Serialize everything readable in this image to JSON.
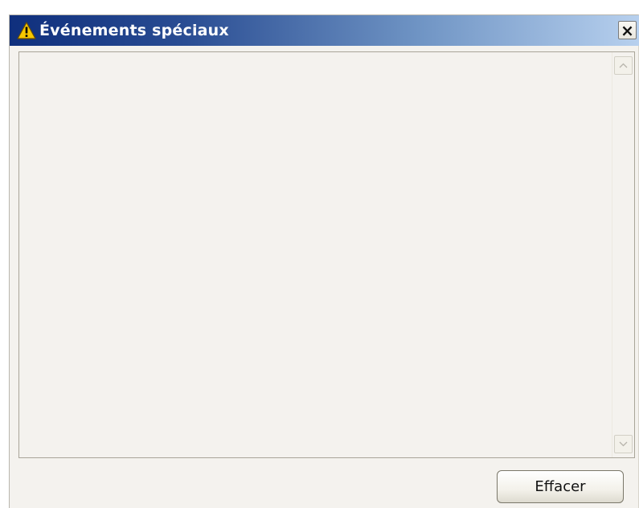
{
  "window": {
    "title": "Événements spéciaux",
    "title_icon": "warning-icon",
    "close_label": "×"
  },
  "list": {
    "items": []
  },
  "scrollbar": {
    "up_icon": "chevron-up-icon",
    "down_icon": "chevron-down-icon"
  },
  "actions": {
    "clear_label": "Effacer"
  },
  "colors": {
    "titlebar_start": "#0f2f7d",
    "titlebar_end": "#b7d0ee",
    "panel_background": "#f4f2ee",
    "warning_yellow": "#f7c800"
  }
}
